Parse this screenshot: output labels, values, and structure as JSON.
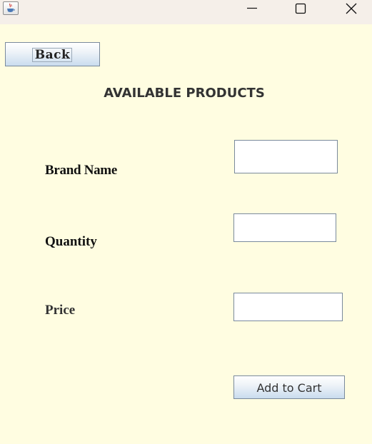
{
  "window": {
    "app_icon": "java-coffee-cup-icon",
    "controls": [
      "minimize-icon",
      "maximize-icon",
      "close-icon"
    ]
  },
  "back_button": {
    "label": "Back"
  },
  "page_title": "AVAILABLE PRODUCTS",
  "form": {
    "brand_name": {
      "label": "Brand Name",
      "value": ""
    },
    "quantity": {
      "label": "Quantity",
      "value": ""
    },
    "price": {
      "label": "Price",
      "value": ""
    }
  },
  "add_to_cart_button": {
    "label": "Add to Cart"
  },
  "colors": {
    "background": "#fffde1",
    "titlebar": "#f5efe9",
    "button_gradient_bottom": "#c9dcee",
    "border": "#7a8a9c"
  }
}
